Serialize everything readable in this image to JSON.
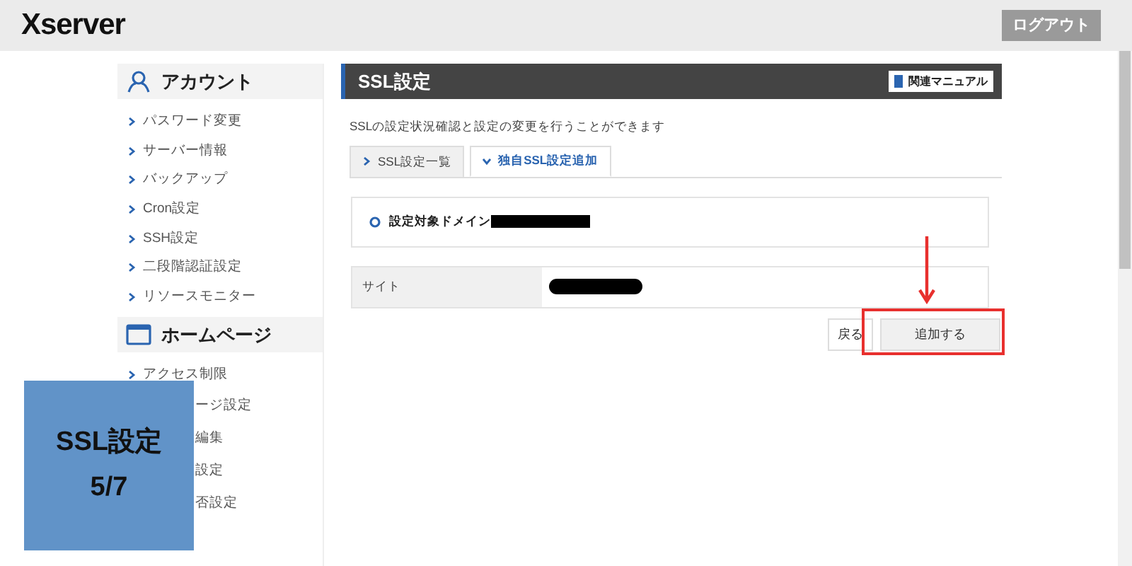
{
  "header": {
    "logo": "Xserver",
    "logout": "ログアウト"
  },
  "sidebar": {
    "sections": [
      {
        "title": "アカウント",
        "kind": "account",
        "items": [
          {
            "label": "パスワード変更",
            "kind": "full"
          },
          {
            "label": "サーバー情報",
            "kind": "full"
          },
          {
            "label": "バックアップ",
            "kind": "full"
          },
          {
            "label": "Cron設定",
            "kind": "full"
          },
          {
            "label": "SSH設定",
            "kind": "full"
          },
          {
            "label": "二段階認証設定",
            "kind": "full"
          },
          {
            "label": "リソースモニター",
            "kind": "full"
          }
        ]
      },
      {
        "title": "ホームページ",
        "kind": "homepage",
        "items": [
          {
            "label": "アクセス制限",
            "kind": "full"
          },
          {
            "label": "ージ設定",
            "kind": "partial"
          },
          {
            "label": "編集",
            "kind": "partial"
          },
          {
            "label": "設定",
            "kind": "partial"
          },
          {
            "label": "否設定",
            "kind": "partial"
          }
        ]
      }
    ]
  },
  "main": {
    "title": "SSL設定",
    "manual_button": "関連マニュアル",
    "description": "SSLの設定状況確認と設定の変更を行うことができます",
    "tabs": [
      {
        "label": "SSL設定一覧",
        "selected": false
      },
      {
        "label": "独自SSL設定追加",
        "selected": true
      }
    ],
    "domain_label": "設定対象ドメイン",
    "table": [
      {
        "label": "サイト"
      }
    ],
    "buttons": [
      {
        "label": "戻る",
        "highlighted": false
      },
      {
        "label": "追加する",
        "highlighted": true
      }
    ]
  },
  "overlay": {
    "title": "SSL設定",
    "step": "5/7"
  }
}
